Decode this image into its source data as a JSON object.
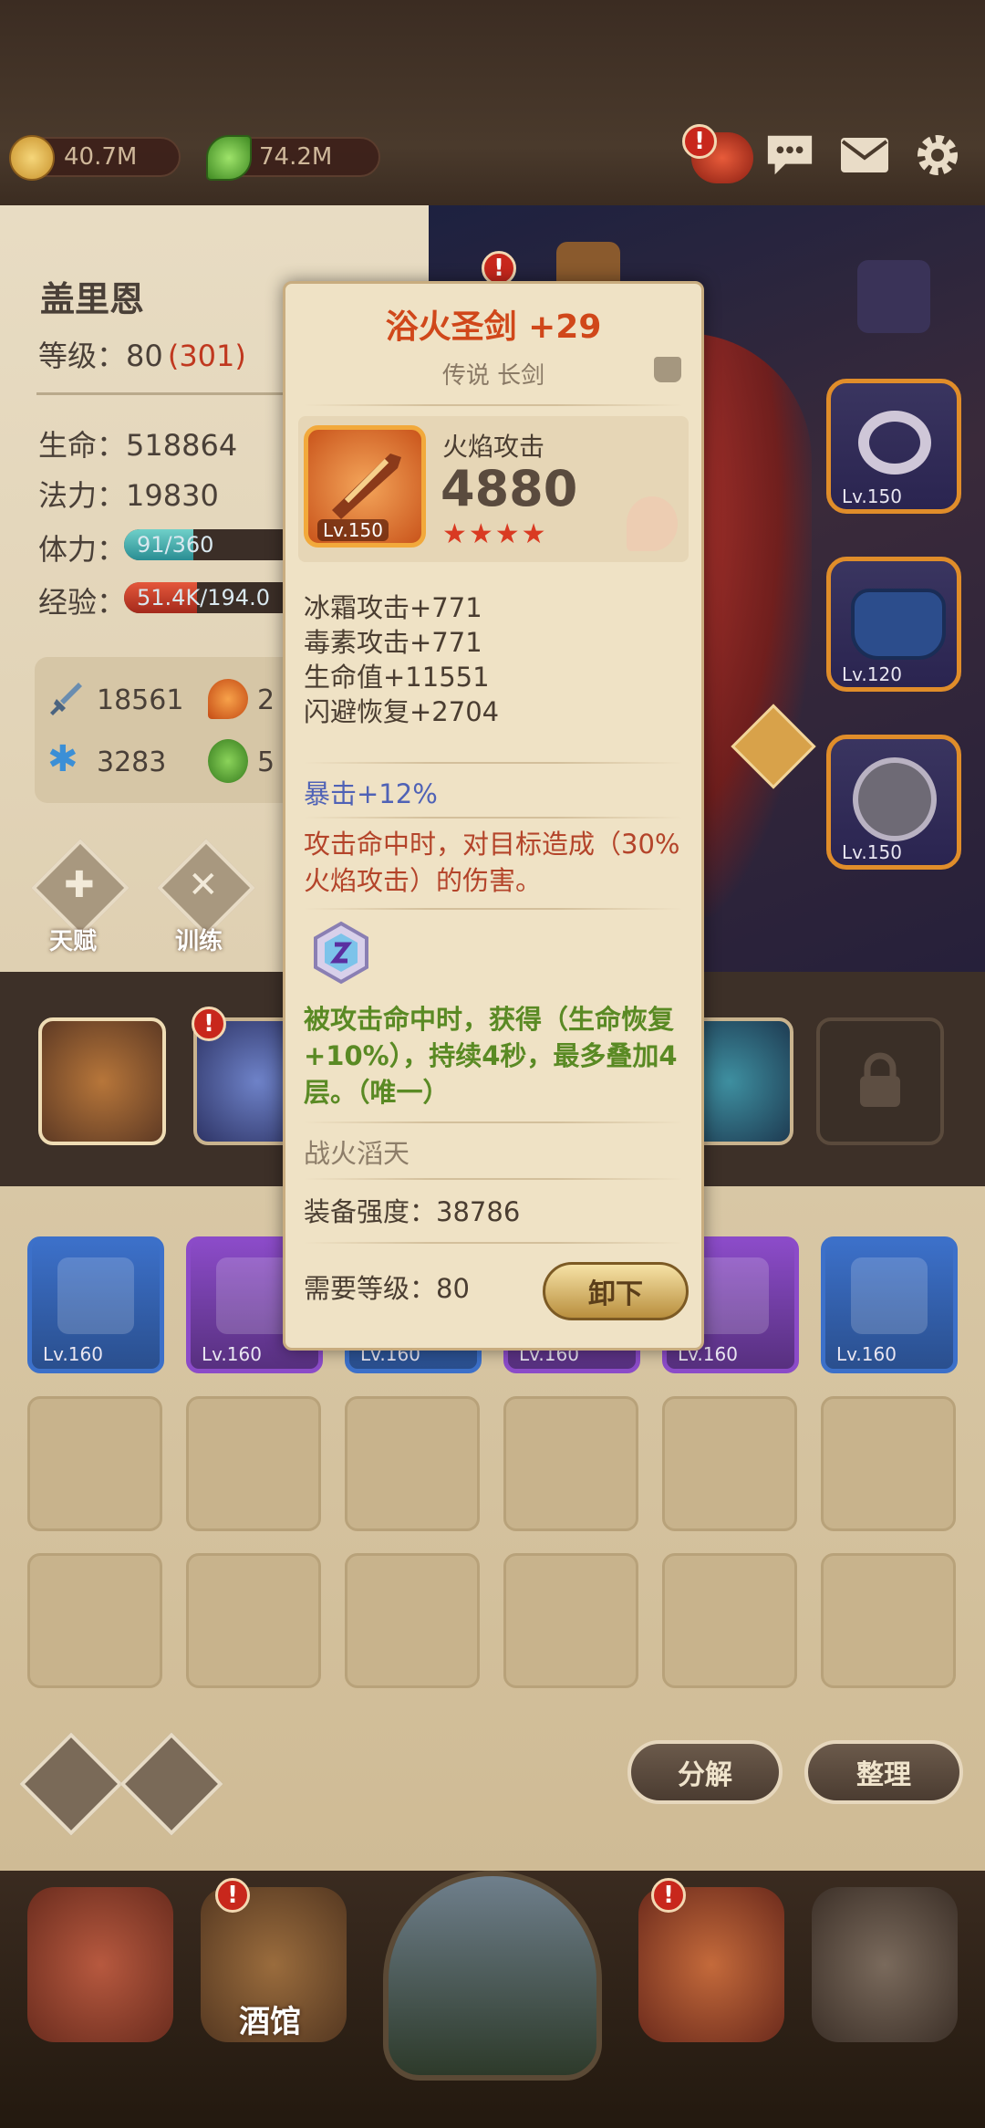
{
  "resources": {
    "gold": "40.7M",
    "gems": "74.2M"
  },
  "hero": {
    "name": "盖里恩",
    "level_label": "等级：",
    "level_value": "80",
    "level_extra": "(301)",
    "hp_label": "生命：",
    "hp_value": "518864",
    "mp_label": "法力：",
    "mp_value": "19830",
    "stamina_label": "体力：",
    "stamina_value": "91/360",
    "stamina_fraction": 0.253,
    "exp_label": "经验：",
    "exp_value": "51.4K/194.0",
    "exp_fraction": 0.265,
    "attack": "18561",
    "fire_partial": "2",
    "ice": "3283",
    "poison_partial": "5"
  },
  "buttons": {
    "talent": "天赋",
    "training": "训练",
    "decompose": "分解",
    "organize": "整理",
    "unequip": "卸下"
  },
  "equipped_slots": {
    "slot1_lv": "Lv.150",
    "slot2_lv": "Lv.120",
    "slot3_lv": "Lv.150"
  },
  "inventory_gear": [
    {
      "lv": "Lv.160",
      "rarity": "blue"
    },
    {
      "lv": "Lv.160",
      "rarity": "purple"
    },
    {
      "lv": "Lv.160",
      "rarity": "blue"
    },
    {
      "lv": "Lv.160",
      "rarity": "purple"
    },
    {
      "lv": "Lv.160",
      "rarity": "purple"
    },
    {
      "lv": "Lv.160",
      "rarity": "blue"
    }
  ],
  "item": {
    "title": "浴火圣剑 +29",
    "subtitle": "传说 长剑",
    "icon_lv": "Lv.150",
    "main_stat_name": "火焰攻击",
    "main_stat_value": "4880",
    "stars": "★★★★",
    "stats": [
      "冰霜攻击+771",
      "毒素攻击+771",
      "生命值+11551",
      "闪避恢复+2704"
    ],
    "crit": "暴击+12%",
    "effect": "攻击命中时，对目标造成（30%火焰攻击）的伤害。",
    "gem_effect": "被攻击命中时，获得（生命恢复+10%），持续4秒，最多叠加4层。（唯一）",
    "set_name": "战火滔天",
    "power_label": "装备强度：",
    "power_value": "38786",
    "req_label": "需要等级：",
    "req_value": "80"
  },
  "nav": {
    "tavern": "酒馆"
  },
  "colors": {
    "title_orange": "#d0471a",
    "crit_blue": "#4f62b6",
    "effect_red": "#b4442a",
    "gem_green": "#5a8a24"
  }
}
